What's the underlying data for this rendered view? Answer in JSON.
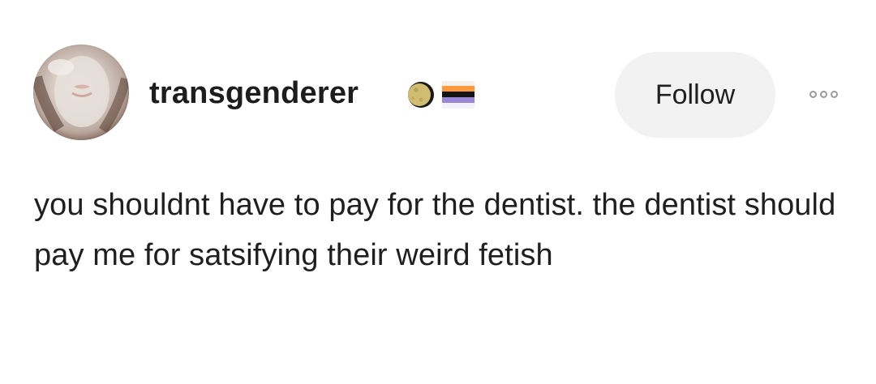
{
  "post": {
    "author": {
      "username": "transgenderer",
      "avatar_icon": "avatar-photo",
      "badges": [
        {
          "icon": "moon-icon",
          "color": "#c9b46a"
        },
        {
          "icon": "flag-icon",
          "colors": [
            "#ff9a3c",
            "#141414",
            "#9b86d6"
          ]
        }
      ]
    },
    "follow_label": "Follow",
    "more_icon": "more-dots-icon",
    "body_text": "you shouldnt have to pay for the dentist. the dentist should pay me for satsifying their weird fetish"
  }
}
